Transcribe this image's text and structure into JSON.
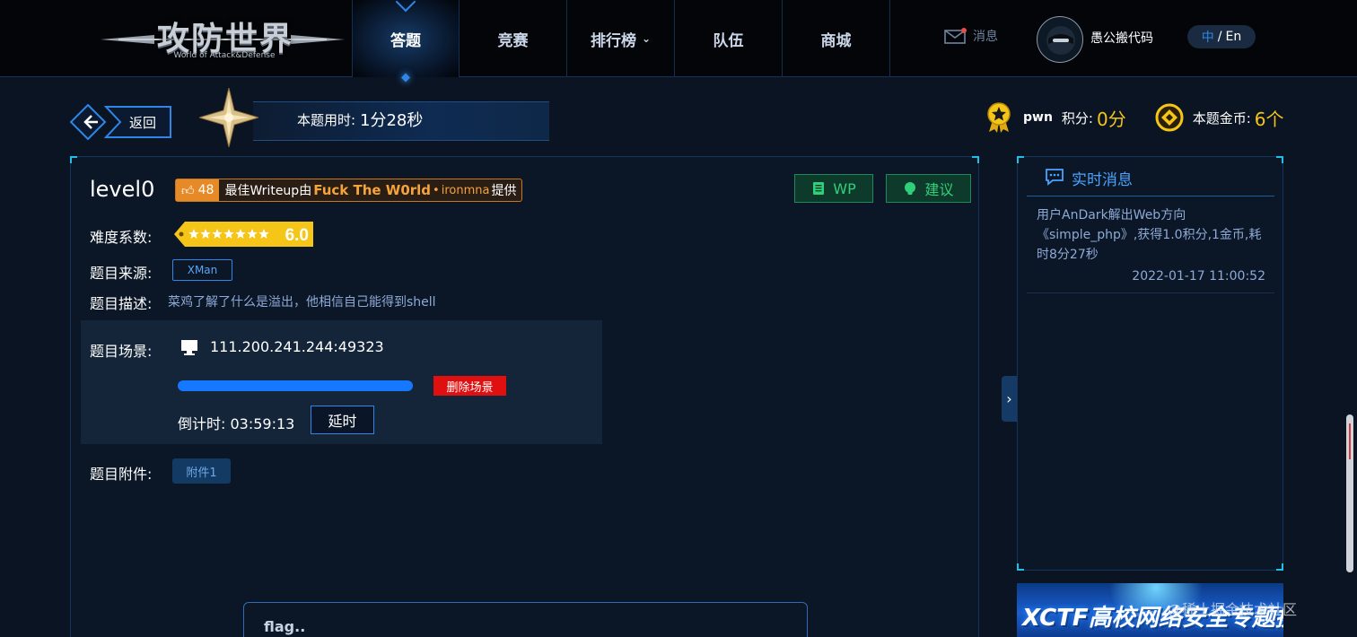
{
  "header": {
    "logo_title": "攻防世界",
    "logo_subtitle": "World of Attack&Defense",
    "nav": [
      {
        "label": "答题",
        "active": true
      },
      {
        "label": "竞赛",
        "active": false
      },
      {
        "label": "排行榜",
        "active": false,
        "has_dropdown": true
      },
      {
        "label": "队伍",
        "active": false
      },
      {
        "label": "商城",
        "active": false
      }
    ],
    "messages_label": "消息",
    "username": "愚公搬代码",
    "lang": {
      "zh": "中",
      "sep": "/",
      "en": "En"
    }
  },
  "subheader": {
    "back_label": "返回",
    "timer_label": "本题用时:",
    "timer_value": "1分28秒",
    "category": "pwn",
    "score_label": "积分:",
    "score_value": "0分",
    "coin_label": "本题金币:",
    "coin_value": "6个"
  },
  "challenge": {
    "title": "level0",
    "writeup": {
      "likes": "48",
      "prefix": "最佳Writeup由",
      "team": "Fuck The W0rld",
      "dot": "•",
      "user": "ironmna",
      "suffix": "提供"
    },
    "wp_button": "WP",
    "suggest_button": "建议",
    "difficulty_label": "难度系数:",
    "difficulty_value": "6.0",
    "difficulty_stars": 7,
    "source_label": "题目来源:",
    "source_value": "XMan",
    "desc_label": "题目描述:",
    "desc_value": "菜鸡了解了什么是溢出，他相信自己能得到shell",
    "scene_label": "题目场景:",
    "scene_address": "111.200.241.244:49323",
    "scene_progress": 1.0,
    "delete_scene": "删除场景",
    "countdown_label": "倒计时:",
    "countdown_value": "03:59:13",
    "delay_button": "延时",
    "attachment_label": "题目附件:",
    "attachment_button": "附件1",
    "flag_placeholder": "flag.."
  },
  "realtime": {
    "title": "实时消息",
    "items": [
      {
        "text": "用户AnDark解出Web方向《simple_php》,获得1.0积分,1金币,耗时8分27秒",
        "time": "2022-01-17 11:00:52"
      }
    ]
  },
  "banner": {
    "text": "XCTF高校网络安全专题挑战赛"
  },
  "watermark": "@稀土掘金技术社区",
  "colors": {
    "accent": "#2f86e6",
    "gold": "#f5c518",
    "danger": "#e01010",
    "green": "#30d07a",
    "orange": "#e58a27"
  }
}
